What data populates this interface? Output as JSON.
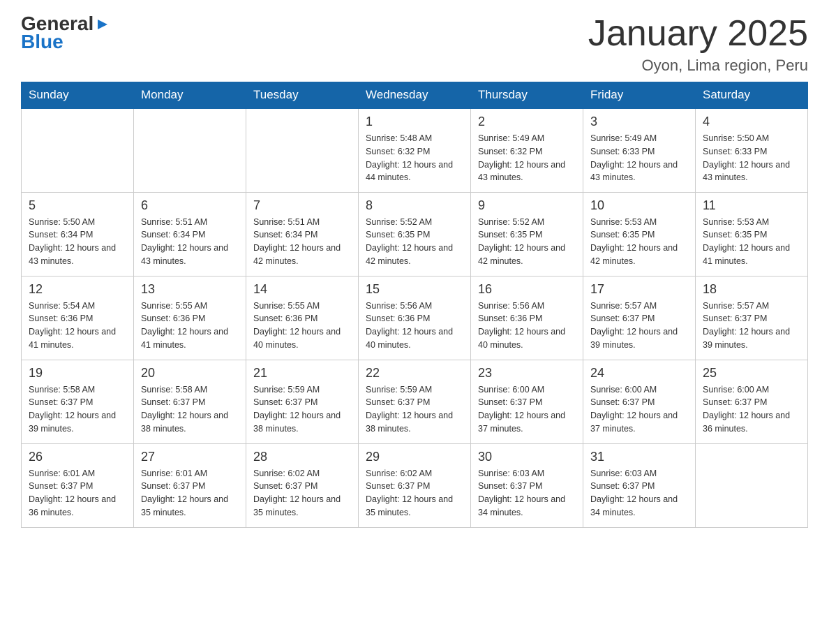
{
  "logo": {
    "line1": "General",
    "arrow": "▶",
    "line2": "Blue"
  },
  "title": "January 2025",
  "location": "Oyon, Lima region, Peru",
  "days_of_week": [
    "Sunday",
    "Monday",
    "Tuesday",
    "Wednesday",
    "Thursday",
    "Friday",
    "Saturday"
  ],
  "weeks": [
    [
      {
        "day": "",
        "info": ""
      },
      {
        "day": "",
        "info": ""
      },
      {
        "day": "",
        "info": ""
      },
      {
        "day": "1",
        "info": "Sunrise: 5:48 AM\nSunset: 6:32 PM\nDaylight: 12 hours and 44 minutes."
      },
      {
        "day": "2",
        "info": "Sunrise: 5:49 AM\nSunset: 6:32 PM\nDaylight: 12 hours and 43 minutes."
      },
      {
        "day": "3",
        "info": "Sunrise: 5:49 AM\nSunset: 6:33 PM\nDaylight: 12 hours and 43 minutes."
      },
      {
        "day": "4",
        "info": "Sunrise: 5:50 AM\nSunset: 6:33 PM\nDaylight: 12 hours and 43 minutes."
      }
    ],
    [
      {
        "day": "5",
        "info": "Sunrise: 5:50 AM\nSunset: 6:34 PM\nDaylight: 12 hours and 43 minutes."
      },
      {
        "day": "6",
        "info": "Sunrise: 5:51 AM\nSunset: 6:34 PM\nDaylight: 12 hours and 43 minutes."
      },
      {
        "day": "7",
        "info": "Sunrise: 5:51 AM\nSunset: 6:34 PM\nDaylight: 12 hours and 42 minutes."
      },
      {
        "day": "8",
        "info": "Sunrise: 5:52 AM\nSunset: 6:35 PM\nDaylight: 12 hours and 42 minutes."
      },
      {
        "day": "9",
        "info": "Sunrise: 5:52 AM\nSunset: 6:35 PM\nDaylight: 12 hours and 42 minutes."
      },
      {
        "day": "10",
        "info": "Sunrise: 5:53 AM\nSunset: 6:35 PM\nDaylight: 12 hours and 42 minutes."
      },
      {
        "day": "11",
        "info": "Sunrise: 5:53 AM\nSunset: 6:35 PM\nDaylight: 12 hours and 41 minutes."
      }
    ],
    [
      {
        "day": "12",
        "info": "Sunrise: 5:54 AM\nSunset: 6:36 PM\nDaylight: 12 hours and 41 minutes."
      },
      {
        "day": "13",
        "info": "Sunrise: 5:55 AM\nSunset: 6:36 PM\nDaylight: 12 hours and 41 minutes."
      },
      {
        "day": "14",
        "info": "Sunrise: 5:55 AM\nSunset: 6:36 PM\nDaylight: 12 hours and 40 minutes."
      },
      {
        "day": "15",
        "info": "Sunrise: 5:56 AM\nSunset: 6:36 PM\nDaylight: 12 hours and 40 minutes."
      },
      {
        "day": "16",
        "info": "Sunrise: 5:56 AM\nSunset: 6:36 PM\nDaylight: 12 hours and 40 minutes."
      },
      {
        "day": "17",
        "info": "Sunrise: 5:57 AM\nSunset: 6:37 PM\nDaylight: 12 hours and 39 minutes."
      },
      {
        "day": "18",
        "info": "Sunrise: 5:57 AM\nSunset: 6:37 PM\nDaylight: 12 hours and 39 minutes."
      }
    ],
    [
      {
        "day": "19",
        "info": "Sunrise: 5:58 AM\nSunset: 6:37 PM\nDaylight: 12 hours and 39 minutes."
      },
      {
        "day": "20",
        "info": "Sunrise: 5:58 AM\nSunset: 6:37 PM\nDaylight: 12 hours and 38 minutes."
      },
      {
        "day": "21",
        "info": "Sunrise: 5:59 AM\nSunset: 6:37 PM\nDaylight: 12 hours and 38 minutes."
      },
      {
        "day": "22",
        "info": "Sunrise: 5:59 AM\nSunset: 6:37 PM\nDaylight: 12 hours and 38 minutes."
      },
      {
        "day": "23",
        "info": "Sunrise: 6:00 AM\nSunset: 6:37 PM\nDaylight: 12 hours and 37 minutes."
      },
      {
        "day": "24",
        "info": "Sunrise: 6:00 AM\nSunset: 6:37 PM\nDaylight: 12 hours and 37 minutes."
      },
      {
        "day": "25",
        "info": "Sunrise: 6:00 AM\nSunset: 6:37 PM\nDaylight: 12 hours and 36 minutes."
      }
    ],
    [
      {
        "day": "26",
        "info": "Sunrise: 6:01 AM\nSunset: 6:37 PM\nDaylight: 12 hours and 36 minutes."
      },
      {
        "day": "27",
        "info": "Sunrise: 6:01 AM\nSunset: 6:37 PM\nDaylight: 12 hours and 35 minutes."
      },
      {
        "day": "28",
        "info": "Sunrise: 6:02 AM\nSunset: 6:37 PM\nDaylight: 12 hours and 35 minutes."
      },
      {
        "day": "29",
        "info": "Sunrise: 6:02 AM\nSunset: 6:37 PM\nDaylight: 12 hours and 35 minutes."
      },
      {
        "day": "30",
        "info": "Sunrise: 6:03 AM\nSunset: 6:37 PM\nDaylight: 12 hours and 34 minutes."
      },
      {
        "day": "31",
        "info": "Sunrise: 6:03 AM\nSunset: 6:37 PM\nDaylight: 12 hours and 34 minutes."
      },
      {
        "day": "",
        "info": ""
      }
    ]
  ]
}
